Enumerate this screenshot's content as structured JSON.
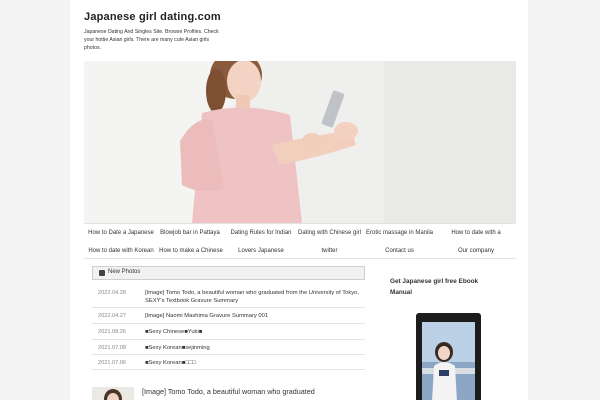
{
  "header": {
    "title": "Japanese girl dating.com",
    "description": "Japanese Dating And Singles Site. Browse Profiles. Check your hottie Asian girls. There are many cute Asian girls photos."
  },
  "nav": {
    "items": [
      {
        "label": "How to Date a Japanese"
      },
      {
        "label": "Blowjob bar in Pattaya"
      },
      {
        "label": "Dating Rules for Indian"
      },
      {
        "label": "Dating with Chinese girl"
      },
      {
        "label": "Erotic massage in Manila"
      },
      {
        "label": "How to date with a"
      },
      {
        "label": "How to date with Korean"
      },
      {
        "label": "How to make a Chinese"
      },
      {
        "label": "Lovers Japanese"
      },
      {
        "label": "twitter"
      },
      {
        "label": "Contact us"
      },
      {
        "label": "Our company"
      }
    ]
  },
  "new_photos": {
    "title": "New Photos",
    "posts": [
      {
        "date": "2022.04.28",
        "title": "[Image] Tomo Todo, a beautiful woman who graduated from the University of Tokyo, SEXY's Textbook Gravure Summary"
      },
      {
        "date": "2022.04.27",
        "title": "[Image] Naomi Mashima Gravure Summary 001"
      },
      {
        "date": "2021.08.26",
        "title": "■Sexy Chinese■Yuki■"
      },
      {
        "date": "2021.07.08",
        "title": "■Sexy Korean■sejinming"
      },
      {
        "date": "2021.07.06",
        "title": "■Sexy Korean■□□□"
      }
    ],
    "feature_title": "[Image] Tomo Todo, a beautiful woman who graduated"
  },
  "sidebar": {
    "ebook_title": "Get Japanese girl free Ebook Manual"
  },
  "colors": {
    "page_bg": "#f3f3f3",
    "content_bg": "#ffffff",
    "text": "#333333",
    "muted": "#888888"
  }
}
